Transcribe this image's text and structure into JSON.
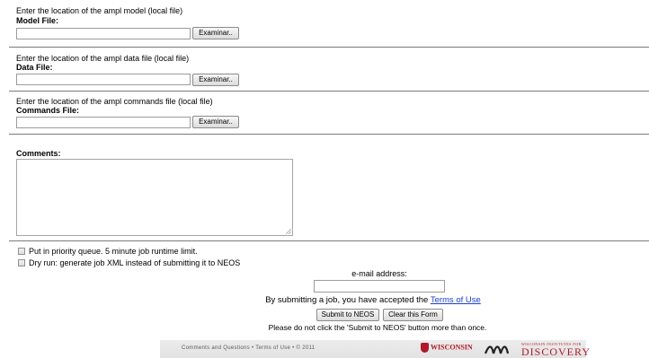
{
  "model_section": {
    "instruction": "Enter the location of the ampl model (local file)",
    "label": "Model File:",
    "browse_label": "Examinar.."
  },
  "data_section": {
    "instruction": "Enter the location of the ampl data file (local file)",
    "label": "Data File:",
    "browse_label": "Examinar.."
  },
  "commands_section": {
    "instruction": "Enter the location of the ampl commands file (local file)",
    "label": "Commands File:",
    "browse_label": "Examinar.."
  },
  "comments": {
    "label": "Comments:",
    "value": ""
  },
  "options": {
    "priority_queue": {
      "label": "Put in priority queue. 5 minute job runtime limit.",
      "checked": false
    },
    "dry_run": {
      "label": "Dry run: generate job XML instead of submitting it to NEOS",
      "checked": false
    }
  },
  "email": {
    "label": "e-mail address:",
    "value": ""
  },
  "terms": {
    "prefix": "By submitting a job, you have accepted the ",
    "link": "Terms of Use"
  },
  "buttons": {
    "submit": "Submit to NEOS",
    "clear": "Clear this Form"
  },
  "warning": "Please do not click the 'Submit to NEOS' button more than once.",
  "footer": {
    "comments_link": "Comments and Questions",
    "sep1": "•",
    "terms_link": "Terms of Use",
    "sep2": "•",
    "copyright": "© 2011",
    "uw_logo": "WISCONSIN",
    "wid_small": "WISCONSIN INSTITUTES FOR",
    "wid_big": "DISCOVERY"
  },
  "colors": {
    "link": "#1a3fcc",
    "brand_red": "#b0172b",
    "divider": "#7a7a7a"
  }
}
